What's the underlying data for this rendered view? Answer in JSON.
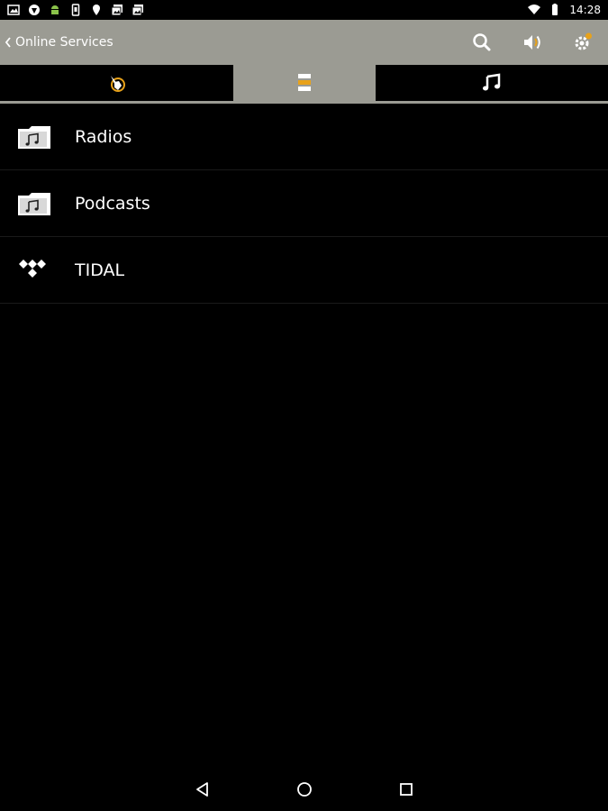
{
  "status_bar": {
    "time": "14:28",
    "left_icons": [
      "image-icon",
      "shield-icon",
      "android-icon",
      "phone-icon",
      "location-pin-icon",
      "photos-icon",
      "photos-icon"
    ],
    "right_icons": [
      "wifi-icon",
      "battery-icon"
    ]
  },
  "action_bar": {
    "title": "Online Services",
    "actions": [
      "search-icon",
      "volume-icon",
      "settings-icon"
    ]
  },
  "tabs": [
    {
      "icon": "hand-pointer-icon",
      "selected": false
    },
    {
      "icon": "list-icon",
      "selected": true
    },
    {
      "icon": "music-note-icon",
      "selected": false
    }
  ],
  "list": {
    "items": [
      {
        "label": "Radios",
        "icon": "music-folder-icon"
      },
      {
        "label": "Podcasts",
        "icon": "music-folder-icon"
      },
      {
        "label": "TIDAL",
        "icon": "tidal-logo-icon"
      }
    ]
  },
  "nav": [
    "back-triangle-icon",
    "home-circle-icon",
    "recents-square-icon"
  ],
  "colors": {
    "bar_gray": "#9b9b93",
    "accent_orange": "#e8a21a",
    "background": "#000000"
  }
}
